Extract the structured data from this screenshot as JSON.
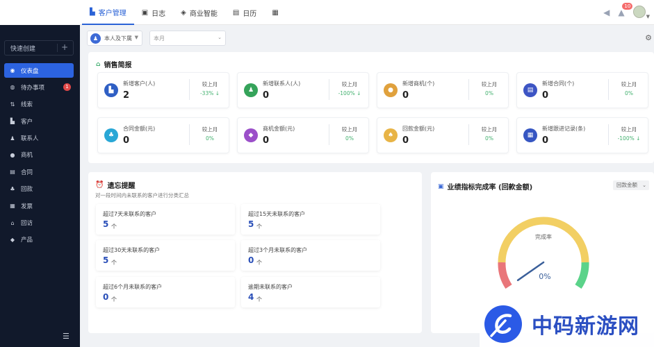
{
  "header": {
    "nav": [
      {
        "label": "客户管理",
        "icon": "customer-icon",
        "active": true
      },
      {
        "label": "日志",
        "icon": "log-icon"
      },
      {
        "label": "商业智能",
        "icon": "bi-icon"
      },
      {
        "label": "日历",
        "icon": "calendar-icon"
      },
      {
        "label": "",
        "icon": "grid-icon"
      }
    ],
    "notify_count": "10"
  },
  "sidebar": {
    "quick_create": "快速创建",
    "items": [
      {
        "label": "仪表盘",
        "icon": "dashboard-icon",
        "active": true
      },
      {
        "label": "待办事项",
        "icon": "todo-icon",
        "badge": "1"
      },
      {
        "label": "线索",
        "icon": "leads-icon"
      },
      {
        "label": "客户",
        "icon": "customer-icon"
      },
      {
        "label": "联系人",
        "icon": "contact-icon"
      },
      {
        "label": "商机",
        "icon": "opportunity-icon"
      },
      {
        "label": "合同",
        "icon": "contract-icon"
      },
      {
        "label": "回款",
        "icon": "payment-icon"
      },
      {
        "label": "发票",
        "icon": "invoice-icon"
      },
      {
        "label": "回访",
        "icon": "visit-icon"
      },
      {
        "label": "产品",
        "icon": "product-icon"
      }
    ]
  },
  "filters": {
    "scope": "本人及下属",
    "period": "本月"
  },
  "sales": {
    "title": "销售简报",
    "compare_label": "较上月",
    "stats": [
      {
        "label": "新增客户(人)",
        "value": "2",
        "pct": "-33% ↓",
        "color": "#2f5fc4"
      },
      {
        "label": "新增联系人(人)",
        "value": "0",
        "pct": "-100% ↓",
        "color": "#35a35a"
      },
      {
        "label": "新增商机(个)",
        "value": "0",
        "pct": "0%",
        "color": "#e0a13d"
      },
      {
        "label": "新增合同(个)",
        "value": "0",
        "pct": "0%",
        "color": "#3d55c4"
      },
      {
        "label": "合同金额(元)",
        "value": "0",
        "pct": "0%",
        "color": "#29a7d6"
      },
      {
        "label": "商机金额(元)",
        "value": "0",
        "pct": "0%",
        "color": "#9b4fc9"
      },
      {
        "label": "回款金额(元)",
        "value": "0",
        "pct": "0%",
        "color": "#e8b446"
      },
      {
        "label": "新增跟进记录(条)",
        "value": "0",
        "pct": "-100% ↓",
        "color": "#3656c2"
      }
    ]
  },
  "reminder": {
    "title": "遗忘提醒",
    "subtitle": "对一段时间内未联系的客户进行分类汇总",
    "unit": "个",
    "items": [
      {
        "label": "超过7天未联系的客户",
        "value": "5"
      },
      {
        "label": "超过15天未联系的客户",
        "value": "5"
      },
      {
        "label": "超过30天未联系的客户",
        "value": "5"
      },
      {
        "label": "超过3个月未联系的客户",
        "value": "0"
      },
      {
        "label": "超过6个月未联系的客户",
        "value": "0"
      },
      {
        "label": "逾期未联系的客户",
        "value": "4"
      }
    ]
  },
  "kpi": {
    "title": "业绩指标完成率 (回款金额)",
    "select": "回款金额",
    "gauge_label": "完成率",
    "gauge_value": "0%",
    "gauge_fraction": 0.0
  },
  "watermark": {
    "text": "中码新游网"
  }
}
